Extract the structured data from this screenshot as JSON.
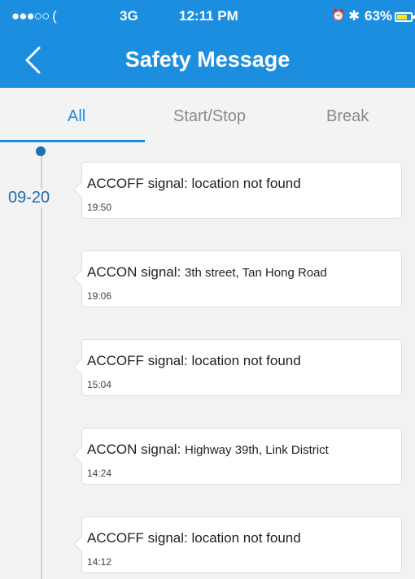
{
  "status_bar": {
    "signal": "●●●○○ (",
    "network": "3G",
    "time": "12:11 PM",
    "alarm_icon": "alarm-icon",
    "bluetooth_icon": "bluetooth-icon",
    "battery": "63%",
    "battery_level": 0.63
  },
  "header": {
    "title": "Safety Message",
    "back_icon": "chevron-left-icon"
  },
  "tabs": [
    {
      "label": "All",
      "active": true
    },
    {
      "label": "Start/Stop",
      "active": false
    },
    {
      "label": "Break",
      "active": false
    }
  ],
  "timeline": {
    "date": "09-20",
    "messages": [
      {
        "signal": "ACCOFF signal:",
        "location": "location not found",
        "time": "19:50"
      },
      {
        "signal": "ACCON signal:",
        "location": "3th street, Tan Hong Road",
        "time": "19:06"
      },
      {
        "signal": "ACCOFF signal:",
        "location": "location not found",
        "time": "15:04"
      },
      {
        "signal": "ACCON signal:",
        "location": "Highway 39th, Link District",
        "time": "14:24"
      },
      {
        "signal": "ACCOFF signal:",
        "location": "location not found",
        "time": "14:12"
      }
    ]
  },
  "colors": {
    "primary": "#1b8ee0",
    "date_text": "#1a6bb0",
    "battery_fill": "#ffe71a"
  }
}
